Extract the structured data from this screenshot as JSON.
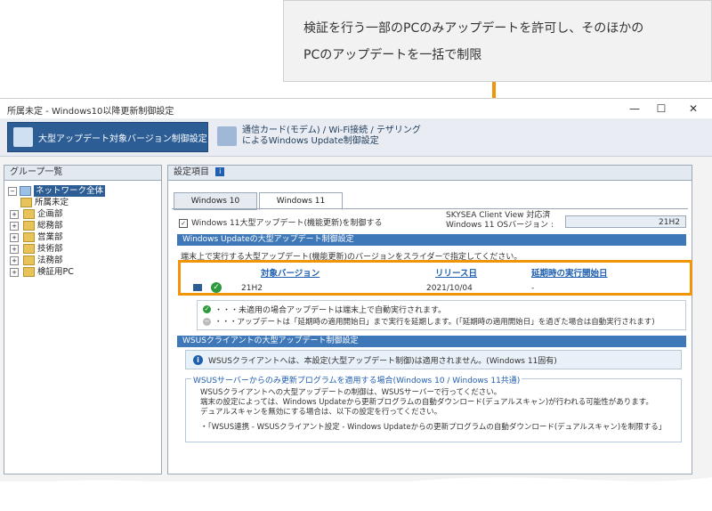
{
  "callout": {
    "line1": "検証を行う一部のPCのみアップデートを許可し、そのほかの",
    "line2": "PCのアップデートを一括で制限"
  },
  "window": {
    "title": "所属未定 - Windows10以降更新制御設定",
    "minimize": "—",
    "maximize": "☐",
    "close": "✕"
  },
  "toolbar": {
    "btn1": "大型アップデート対象バージョン制御設定",
    "btn2_line1": "通信カード(モデム) / Wi-Fi接続 / テザリング",
    "btn2_line2": "によるWindows Update制御設定"
  },
  "left_panel": {
    "title": "グループ一覧",
    "items": [
      "ネットワーク全体",
      "所属未定",
      "企画部",
      "総務部",
      "営業部",
      "技術部",
      "法務部",
      "検証用PC"
    ]
  },
  "right_panel": {
    "title": "設定項目",
    "tabs": [
      "Windows 10",
      "Windows 11"
    ],
    "checkbox_label": "Windows 11大型アップデート(機能更新)を制御する",
    "skysea_label1": "SKYSEA Client View 対応済",
    "skysea_label2": "Windows 11 OSバージョン :",
    "skysea_value": "21H2",
    "section1": "Windows Updateの大型アップデート制御設定",
    "desc": "端末上で実行する大型アップデート(機能更新)のバージョンをスライダーで指定してください。",
    "col1": "対象バージョン",
    "col2": "リリース日",
    "col3": "延期時の実行開始日",
    "row": {
      "version": "21H2",
      "release": "2021/10/04",
      "start": "-"
    },
    "legend1": "・・・未適用の場合アップデートは端末上で自動実行されます。",
    "legend2": "・・・アップデートは「延期時の適用開始日」まで実行を延期します。(「延期時の適用開始日」を過ぎた場合は自動実行されます)",
    "section2": "WSUSクライアントの大型アップデート制御設定",
    "info": "WSUSクライアントへは、本設定(大型アップデート制御)は適用されません。(Windows 11固有)",
    "fieldset_title": "WSUSサーバーからのみ更新プログラムを適用する場合(Windows 10 / Windows 11共通)",
    "fs_line1": "WSUSクライアントへの大型アップデートの制御は、WSUSサーバーで行ってください。",
    "fs_line2": "端末の設定によっては、Windows Updateから更新プログラムの自動ダウンロード(デュアルスキャン)が行われる可能性があります。",
    "fs_line3": "デュアルスキャンを無効にする場合は、以下の設定を行ってください。",
    "fs_line4": "・「WSUS連携 - WSUSクライアント設定 - Windows Updateからの更新プログラムの自動ダウンロード(デュアルスキャン)を制限する」"
  }
}
